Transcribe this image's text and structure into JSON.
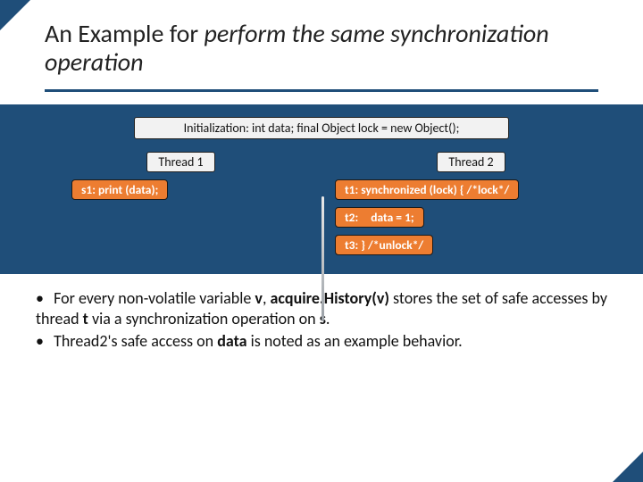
{
  "title": {
    "pre": "An Example for ",
    "em": "perform the same synchronization operation"
  },
  "init": "Initialization: int data; final Object lock = new Object();",
  "thread1": {
    "label": "Thread 1",
    "s1": "s1: print (data);"
  },
  "thread2": {
    "label": "Thread 2",
    "t1": "t1: synchronized (lock) { /*lock*/",
    "t2a": "t2:",
    "t2b": "data = 1;",
    "t3": "t3: } /*unlock*/"
  },
  "bullets": {
    "b1a": "For every non-volatile variable ",
    "b1v": "v",
    "b1b": ", ",
    "b1fn": "acquire.History(v)",
    "b1c": " stores the set of safe accesses by thread ",
    "b1t": "t",
    "b1d": " via a synchronization operation on ",
    "b1s": "s",
    "b1e": ".",
    "b2a": "Thread2's safe access on ",
    "b2data": "data",
    "b2b": " is noted as an example behavior."
  }
}
